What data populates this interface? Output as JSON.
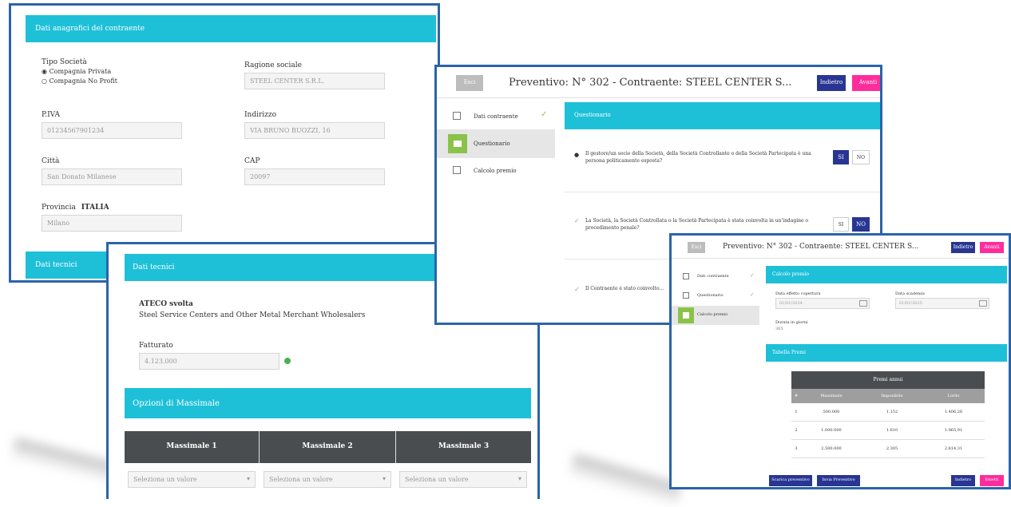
{
  "w1": {
    "header": "Dati anagrafici del contraente",
    "tipo_label": "Tipo Società",
    "tipo_options": [
      "Compagnia Privata",
      "Compagnia No Profit"
    ],
    "ragione_label": "Ragione sociale",
    "ragione_value": "STEEL CENTER S.R.L.",
    "piva_label": "P.IVA",
    "piva_value": "01234567901234",
    "indirizzo_label": "Indirizzo",
    "indirizzo_value": "VIA BRUNO BUOZZI, 16",
    "citta_label": "Città",
    "citta_value": "San Donato Milanese",
    "cap_label": "CAP",
    "cap_value": "20097",
    "provincia_label": "Provincia",
    "provincia_country": "ITALIA",
    "provincia_value": "Milano",
    "footer_header": "Dati tecnici"
  },
  "w2": {
    "header": "Dati tecnici",
    "ateco_label": "ATECO svolta",
    "ateco_value": "Steel Service Centers and Other Metal Merchant Wholesalers",
    "fatturato_label": "Fatturato",
    "fatturato_value": "4.123.000",
    "opzioni_header": "Opzioni di Massimale",
    "columns": [
      "Massimale 1",
      "Massimale 2",
      "Massimale 3"
    ],
    "selects": [
      "Seleziona un valore",
      "Seleziona un valore",
      "Seleziona un valore"
    ]
  },
  "w3": {
    "back": "Esci",
    "title": "Preventivo: N° 302 - Contraente: STEEL CENTER S...",
    "btn_navy": "Indietro",
    "btn_pink": "Avanti",
    "nav": [
      "Dati contraente",
      "Questionario",
      "Calcolo premio"
    ],
    "section": "Questionario",
    "questions": [
      "Il gestore/un socio della Società, della Società Controllante o della Società Partecipata è una persona politicamente esposta?",
      "La Società, la Società Controllata o la Società Partecipata è stata coinvolta in un'indagine o procedimento penale?",
      "Il Contraente è stato coinvolto..."
    ],
    "yes": "SI",
    "no": "NO"
  },
  "w4": {
    "back": "Esci",
    "title": "Preventivo: N° 302 - Contraente: STEEL CENTER S...",
    "btn_navy": "Indietro",
    "btn_pink": "Avanti",
    "nav": [
      "Dati contraente",
      "Questionario",
      "Calcolo premio"
    ],
    "section1": "Calcolo premio",
    "data_label": "Data effetto copertura",
    "data_value": "01/01/2024",
    "scad_label": "Data scadenza",
    "scad_value": "01/01/2025",
    "durata_label": "Durata in giorni",
    "durata_value": "365",
    "section2": "Tabella Premi",
    "table_title": "Premi annui",
    "table_headers": [
      "#",
      "Massimale",
      "Imponibile",
      "Lordo"
    ],
    "rows": [
      [
        "1",
        "500.000",
        "1.152",
        "1.406,26"
      ],
      [
        "2",
        "1.000.000",
        "1.610",
        "1.965,91"
      ],
      [
        "3",
        "2.500.000",
        "2.305",
        "2.814,31"
      ]
    ],
    "btn_left1": "Scarica preventivo",
    "btn_left2": "Invia Preventivo",
    "btn_right_navy": "Indietro",
    "btn_right_pink": "Emetti"
  }
}
